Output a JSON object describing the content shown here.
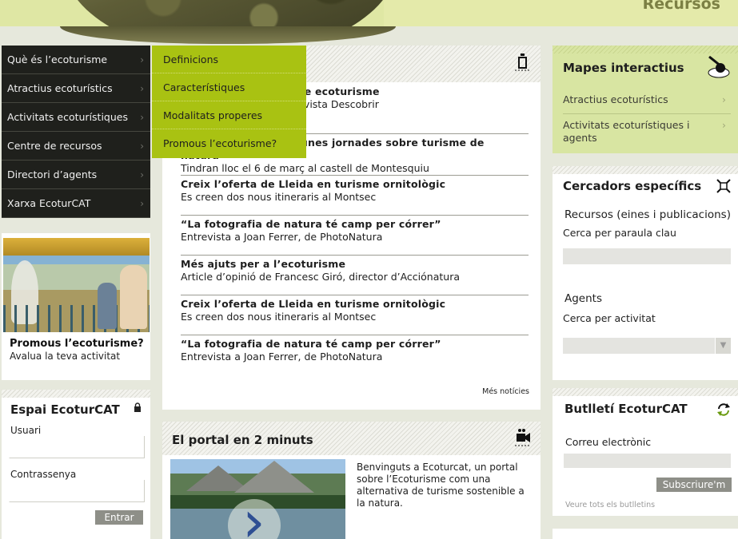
{
  "header": {
    "section_title": "Recursos"
  },
  "nav": {
    "items": [
      {
        "label": "Què és l’ecoturisme"
      },
      {
        "label": "Atractius ecoturístics"
      },
      {
        "label": "Activitats ecoturístiques"
      },
      {
        "label": "Centre de recursos"
      },
      {
        "label": "Directori d’agents"
      },
      {
        "label": "Xarxa EcoturCAT"
      }
    ],
    "arrow": "›",
    "submenu": [
      "Definicions",
      "Característiques",
      "Modalitats properes",
      "Promous l’ecoturisme?"
    ]
  },
  "promo": {
    "title": "Promous l’ecoturisme?",
    "subtitle": "Avalua la teva activitat"
  },
  "login": {
    "title": "Espai EcoturCAT",
    "user_label": "Usuari",
    "password_label": "Contrassenya",
    "submit_label": "Entrar",
    "icon": "lock-icon"
  },
  "news": {
    "icon": "rss-icon",
    "items": [
      {
        "title": "Guia divulgativa sobre ecoturisme",
        "summary": "Número de juliol de la revista Descobrir"
      },
      {
        "title": "Barcelona organitza unes jornades sobre turisme de natura",
        "summary": "Tindran lloc el 6 de març al castell de Montesquiu"
      },
      {
        "title": "Creix l’oferta de Lleida en turisme ornitològic",
        "summary": "Es creen dos nous itineraris al Montsec"
      },
      {
        "title": "“La fotografia de natura té camp per córrer”",
        "summary": "Entrevista a Joan Ferrer, de PhotoNatura"
      },
      {
        "title": "Més ajuts per a l’ecoturisme",
        "summary": "Article d’opinió de Francesc Giró, director d’Acciónatura"
      },
      {
        "title": "Creix l’oferta de Lleida en turisme ornitològic",
        "summary": "Es creen dos nous itineraris al Montsec"
      },
      {
        "title": "“La fotografia de natura té camp per córrer”",
        "summary": "Entrevista a Joan Ferrer, de PhotoNatura"
      }
    ],
    "more_label": "Més notícies"
  },
  "portal": {
    "title": "El portal en 2 minuts",
    "text": "Benvinguts a Ecoturcat, un portal sobre l’Ecoturisme com una alternativa de turisme sostenible a la natura.",
    "icon": "video-camera-icon"
  },
  "maps": {
    "title": "Mapes interactius",
    "links": [
      "Atractius ecoturístics",
      "Activitats ecoturístiques i agents"
    ],
    "icon": "map-pin-icon"
  },
  "search": {
    "title": "Cercadors específics",
    "resources_label": "Recursos (eines i publicacions)",
    "resources_sub": "Cerca per paraula clau",
    "agents_label": "Agents",
    "agents_sub": "Cerca per activitat",
    "icon": "crosshair-icon"
  },
  "newsletter": {
    "title": "Butlletí EcoturCAT",
    "email_label": "Correu electrònic",
    "subscribe_label": "Subscriure'm",
    "all_label": "Veure tots els butlletins",
    "icon": "refresh-icon"
  },
  "colors": {
    "accent": "#a9c212",
    "nav_bg": "#1f201c",
    "maps_bg": "#d8e5a2"
  }
}
